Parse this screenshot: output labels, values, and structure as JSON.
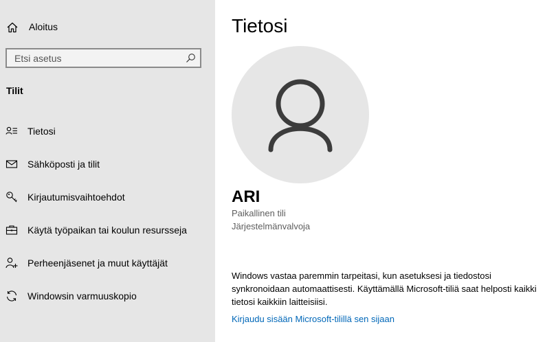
{
  "sidebar": {
    "home_label": "Aloitus",
    "search_placeholder": "Etsi asetus",
    "section_title": "Tilit",
    "items": [
      {
        "label": "Tietosi",
        "icon": "person-list-icon"
      },
      {
        "label": "Sähköposti ja tilit",
        "icon": "mail-icon"
      },
      {
        "label": "Kirjautumisvaihtoehdot",
        "icon": "key-icon"
      },
      {
        "label": "Käytä työpaikan tai koulun resursseja",
        "icon": "briefcase-icon"
      },
      {
        "label": "Perheenjäsenet ja muut käyttäjät",
        "icon": "add-person-icon"
      },
      {
        "label": "Windowsin varmuuskopio",
        "icon": "sync-icon"
      }
    ]
  },
  "main": {
    "title": "Tietosi",
    "user_name": "ARI",
    "account_type": "Paikallinen tili",
    "role": "Järjestelmänvalvoja",
    "info_text": "Windows vastaa paremmin tarpeitasi, kun asetuksesi ja tiedostosi synkronoidaan automaattisesti. Käyttämällä Microsoft-tiliä saat helposti kaikki tietosi kaikkiin laitteisiisi.",
    "link_text": "Kirjaudu sisään Microsoft-tilillä sen sijaan"
  },
  "colors": {
    "sidebar_bg": "#e6e6e6",
    "link": "#0067b8",
    "avatar_bg": "#e6e6e6",
    "avatar_fg": "#3c3c3c"
  }
}
